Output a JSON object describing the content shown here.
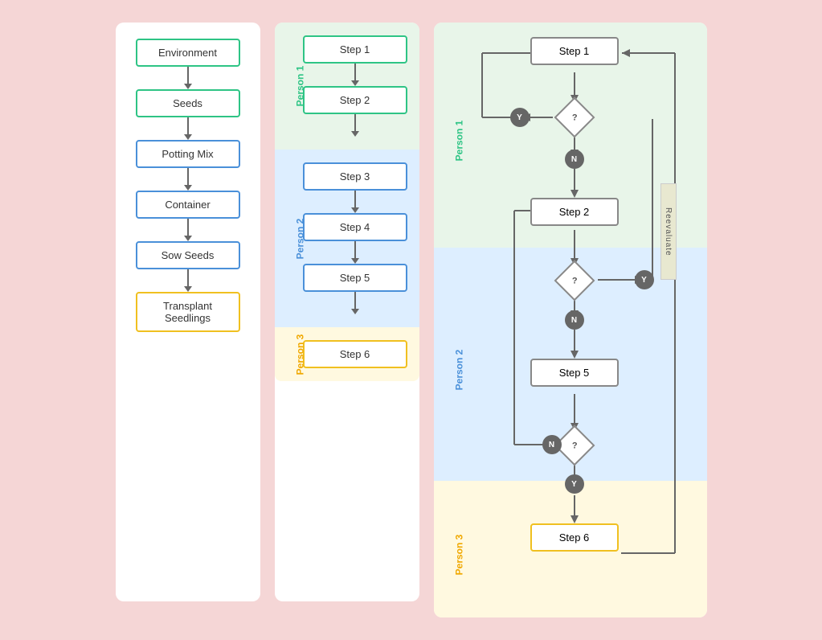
{
  "panel1": {
    "boxes": [
      {
        "label": "Environment",
        "style": "green"
      },
      {
        "label": "Seeds",
        "style": "green"
      },
      {
        "label": "Potting Mix",
        "style": "blue"
      },
      {
        "label": "Container",
        "style": "blue"
      },
      {
        "label": "Sow Seeds",
        "style": "blue"
      },
      {
        "label": "Transplant\nSeedlings",
        "style": "yellow"
      }
    ]
  },
  "panel2": {
    "swimlanes": [
      {
        "label": "Person 1",
        "color": "green",
        "steps": [
          "Step 1",
          "Step 2"
        ]
      },
      {
        "label": "Person 2",
        "color": "blue",
        "steps": [
          "Step 3",
          "Step 4",
          "Step 5"
        ]
      },
      {
        "label": "Person 3",
        "color": "yellow",
        "steps": [
          "Step 6"
        ]
      }
    ]
  },
  "panel3": {
    "swimlanes": [
      {
        "label": "Person 1",
        "color": "green"
      },
      {
        "label": "Person 2",
        "color": "blue"
      },
      {
        "label": "Person 3",
        "color": "yellow"
      }
    ],
    "steps": {
      "step1": "Step 1",
      "step2": "Step 2",
      "step5": "Step 5",
      "step6": "Step 6",
      "reevaluate": "Reevaluate",
      "diamond_q": "?",
      "y": "Y",
      "n": "N"
    }
  }
}
